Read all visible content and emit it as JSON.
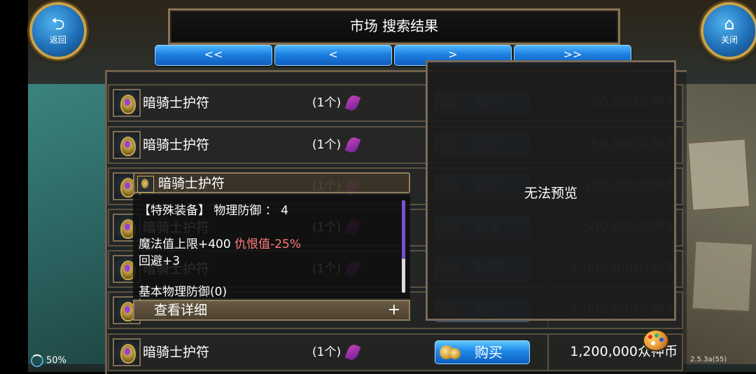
{
  "header": {
    "title": "市场 搜索结果",
    "back_label": "返回",
    "close_label": "关闭"
  },
  "pagination": {
    "first": "<<",
    "prev": "<",
    "next": ">",
    "last": ">>"
  },
  "listings": [
    {
      "name": "暗骑士护符",
      "qty": "(1个)",
      "buy": "购买",
      "price": "50,000众神币"
    },
    {
      "name": "暗骑士护符",
      "qty": "(1个)",
      "buy": "购买",
      "price": "50,000众神币"
    },
    {
      "name": "暗骑士护符",
      "qty": "(1个)",
      "buy": "购买",
      "price": "100,000众神币"
    },
    {
      "name": "暗骑士护符",
      "qty": "(1个)",
      "buy": "购买",
      "price": "500,000众神币"
    },
    {
      "name": "暗骑士护符",
      "qty": "(1个)",
      "buy": "购买",
      "price": "1,000,000众神币"
    },
    {
      "name": "暗骑士护符",
      "qty": "(1个)",
      "buy": "购买",
      "price": "1,000,000众神币"
    },
    {
      "name": "暗骑士护符",
      "qty": "(1个)",
      "buy": "购买",
      "price": "1,200,000众神币"
    }
  ],
  "preview": {
    "message": "无法预览"
  },
  "tooltip": {
    "item_name": "暗骑士护符",
    "line1": "【特殊装备】 物理防御 ： 4",
    "line2_prefix": "魔法值上限+400 ",
    "line2_hate": "仇恨值-25%",
    "line3": "回避+3",
    "line4": "基本物理防御(0)",
    "details_label": "查看详细",
    "details_icon": "+",
    "scroll_fraction": 0.64
  },
  "status": {
    "battery": "50%",
    "version": "2.5.3a(55)"
  },
  "colors": {
    "button_blue": "#1f88e6",
    "frame_gold": "#c9a24a",
    "hate_red": "#ff7a7a"
  }
}
